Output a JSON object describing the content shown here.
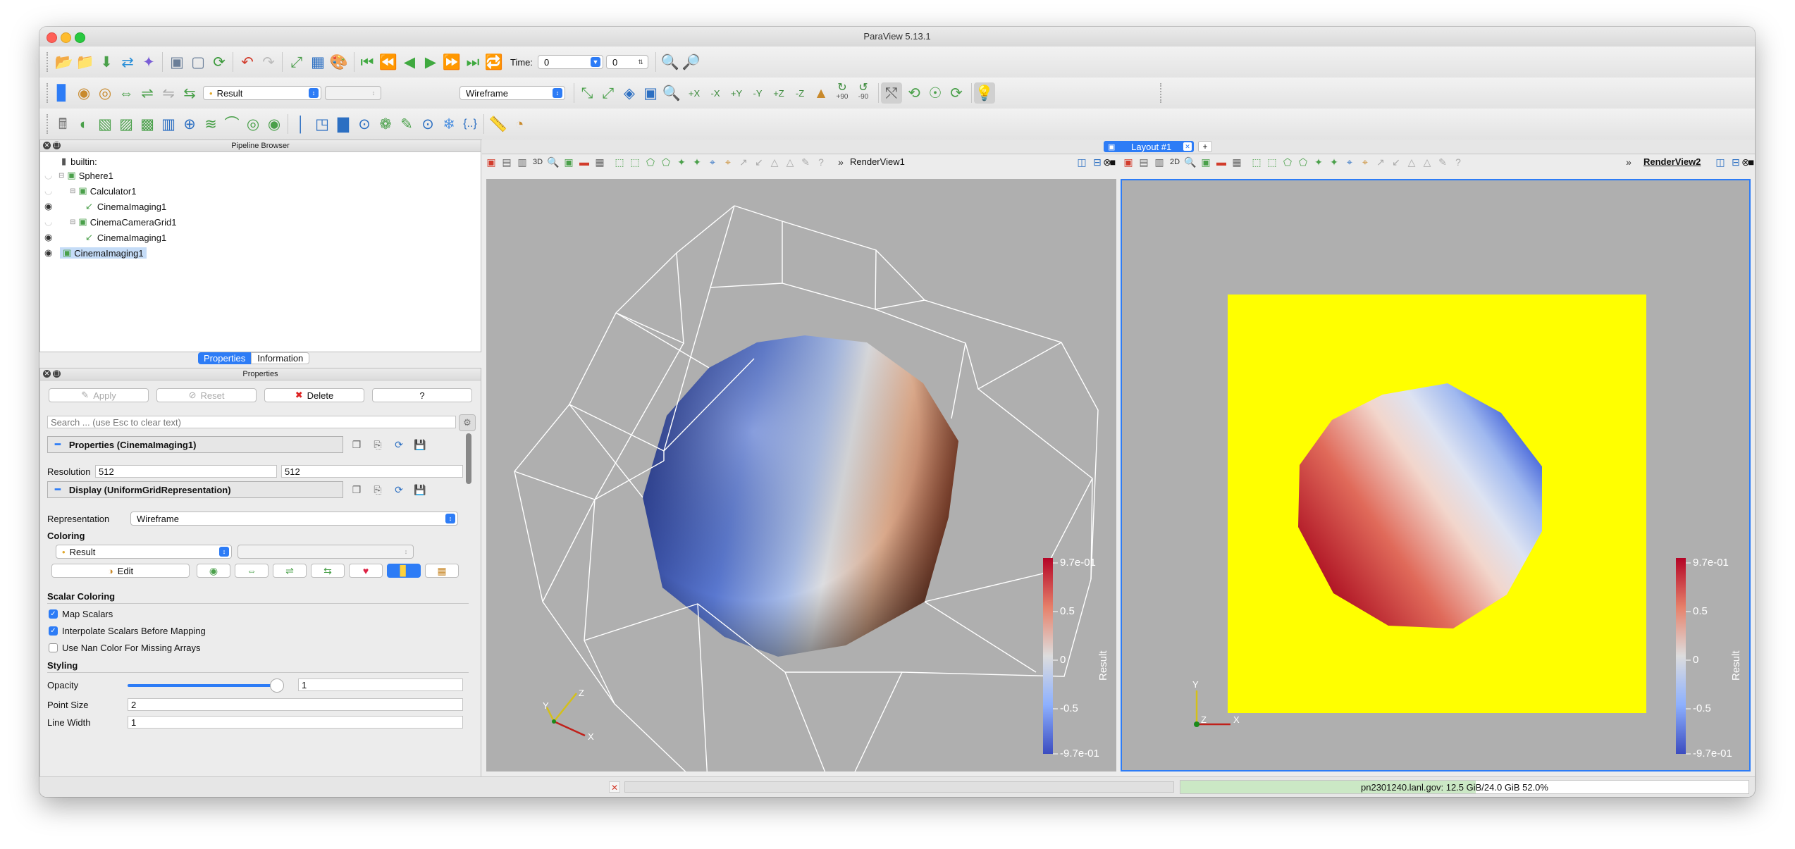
{
  "window": {
    "title": "ParaView 5.13.1"
  },
  "toolbar": {
    "time_label": "Time:",
    "time_value": "0",
    "timestep_value": "0",
    "color_array": "Result",
    "representation": "Wireframe",
    "rotate_plus90": "+90",
    "rotate_minus90": "-90",
    "axis_labels": {
      "px": "+X",
      "mx": "-X",
      "py": "+Y",
      "my": "-Y",
      "pz": "+Z",
      "mz": "-Z"
    }
  },
  "pipeline_browser": {
    "title": "Pipeline Browser",
    "items": [
      {
        "label": "builtin:"
      },
      {
        "label": "Sphere1"
      },
      {
        "label": "Calculator1"
      },
      {
        "label": "CinemaImaging1"
      },
      {
        "label": "CinemaCameraGrid1"
      },
      {
        "label": "CinemaImaging1"
      },
      {
        "label": "CinemaImaging1"
      }
    ]
  },
  "tabs": {
    "properties": "Properties",
    "information": "Information"
  },
  "properties": {
    "title": "Properties",
    "apply": "Apply",
    "reset": "Reset",
    "delete": "Delete",
    "help": "?",
    "search_placeholder": "Search ... (use Esc to clear text)",
    "section_properties": "Properties (CinemaImaging1)",
    "resolution_label": "Resolution",
    "resolution_x": "512",
    "resolution_y": "512",
    "section_display": "Display (UniformGridRepresentation)",
    "representation_label": "Representation",
    "representation_value": "Wireframe",
    "coloring_label": "Coloring",
    "coloring_value": "Result",
    "edit_label": "Edit",
    "scalar_coloring_label": "Scalar Coloring",
    "map_scalars": "Map Scalars",
    "interpolate_scalars": "Interpolate Scalars Before Mapping",
    "nan_color": "Use Nan Color For Missing Arrays",
    "styling_label": "Styling",
    "opacity_label": "Opacity",
    "opacity_value": "1",
    "opacity_fraction": 1,
    "point_size_label": "Point Size",
    "point_size_value": "2",
    "line_width_label": "Line Width",
    "line_width_value": "1"
  },
  "layout": {
    "tab_label": "Layout #1",
    "add_label": "+"
  },
  "view1": {
    "name": "RenderView1",
    "mode": "3D",
    "colorbar": {
      "title": "Result",
      "ticks": [
        "9.7e-01",
        "0.5",
        "0",
        "-0.5",
        "-9.7e-01"
      ]
    }
  },
  "view2": {
    "name": "RenderView2",
    "mode": "2D",
    "colorbar": {
      "title": "Result",
      "ticks": [
        "9.7e-01",
        "0.5",
        "0",
        "-0.5",
        "-9.7e-01"
      ]
    }
  },
  "statusbar": {
    "memory": "pn2301240.lanl.gov: 12.5 GiB/24.0 GiB 52.0%"
  },
  "colors": {
    "accent": "#2d7cf6",
    "colormap_high": "#b40426",
    "colormap_low": "#3b4cc0",
    "background2": "#ffff00"
  }
}
